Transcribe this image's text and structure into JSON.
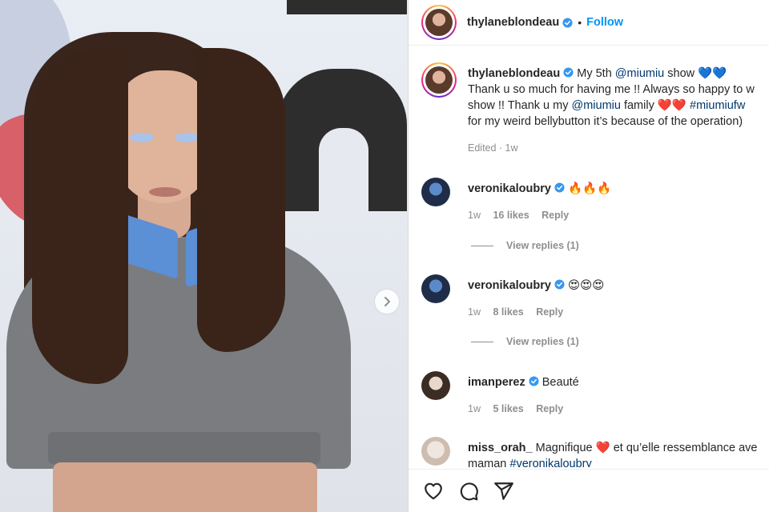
{
  "photo": {
    "alt": ""
  },
  "header": {
    "username": "thylaneblondeau",
    "separator": "•",
    "follow_label": "Follow"
  },
  "caption": {
    "username": "thylaneblondeau",
    "line1_text": "My 5th",
    "line1_mention": "@miumiu",
    "line1_after": "show",
    "line1_emoji": "💙💙",
    "line2": "Thank u so much for having me !! Always so happy to w",
    "line3_text": "show !! Thank u my",
    "line3_mention": "@miumiu",
    "line3_after": "family",
    "line3_emoji": "❤️❤️",
    "line3_hashtag": "#miumiufw",
    "line4": "for my weird bellybutton it’s because of the operation)",
    "meta": "Edited · 1w"
  },
  "comments": [
    {
      "username": "veronikaloubry",
      "text": "🔥🔥🔥",
      "time": "1w",
      "likes": "16 likes",
      "reply": "Reply",
      "view_replies": "View replies (1)"
    },
    {
      "username": "veronikaloubry",
      "text": "😍😍😍",
      "time": "1w",
      "likes": "8 likes",
      "reply": "Reply",
      "view_replies": "View replies (1)"
    },
    {
      "username": "imanperez",
      "text": "Beauté",
      "time": "1w",
      "likes": "5 likes",
      "reply": "Reply"
    },
    {
      "username": "miss_orah_",
      "text_before": "Magnifique",
      "emoji": "❤️",
      "text_after": "et qu’elle ressemblance ave",
      "line2_text": "maman",
      "line2_hashtag": "#veronikaloubry"
    }
  ],
  "actions": {
    "like": "heart-icon",
    "comment": "comment-icon",
    "share": "share-icon"
  },
  "colors": {
    "link": "#00376b",
    "follow": "#0095f6",
    "verified": "#3897f0",
    "muted": "#8e8e8e"
  }
}
